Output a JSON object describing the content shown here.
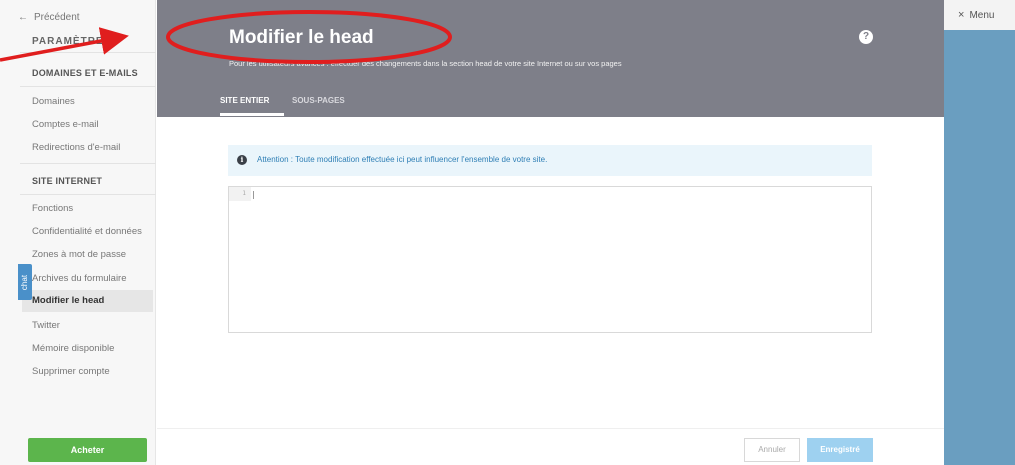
{
  "sidebar": {
    "back_label": "Précédent",
    "back_icon": "arrow-left-icon",
    "title": "PARAMÈTRES",
    "sections": [
      {
        "label": "DOMAINES ET E-MAILS"
      },
      {
        "label": "SITE INTERNET"
      }
    ],
    "items": [
      {
        "label": "Domaines"
      },
      {
        "label": "Comptes e-mail"
      },
      {
        "label": "Redirections d'e-mail"
      },
      {
        "label": "Fonctions"
      },
      {
        "label": "Confidentialité et données"
      },
      {
        "label": "Zones à mot de passe"
      },
      {
        "label": "Archives du formulaire"
      },
      {
        "label": "Modifier le head"
      },
      {
        "label": "Twitter"
      },
      {
        "label": "Mémoire disponible"
      },
      {
        "label": "Supprimer compte"
      }
    ],
    "active_item": "Modifier le head",
    "buy_label": "Acheter",
    "chat_label": "chat"
  },
  "header": {
    "title": "Modifier le head",
    "subtitle": "Pour les utilisateurs avancés : effectuer des changements dans la section head de votre site Internet ou sur vos pages",
    "help_label": "?",
    "tabs": [
      {
        "label": "SITE ENTIER",
        "active": true
      },
      {
        "label": "SOUS-PAGES",
        "active": false
      }
    ]
  },
  "alert": {
    "icon": "info-icon",
    "icon_glyph": "i",
    "text": "Attention : Toute modification effectuée ici peut influencer l'ensemble de votre site."
  },
  "editor": {
    "line_number": "1",
    "content": ""
  },
  "footer": {
    "cancel_label": "Annuler",
    "save_label": "Enregistré"
  },
  "right_panel": {
    "close_glyph": "×",
    "menu_label": "Menu"
  },
  "colors": {
    "header_bg": "#7e7f89",
    "accent_green": "#5cb54c",
    "save_blue": "#9ed1f0",
    "annotation_red": "#e01e1e",
    "right_panel_bg": "#6a9ec0"
  }
}
